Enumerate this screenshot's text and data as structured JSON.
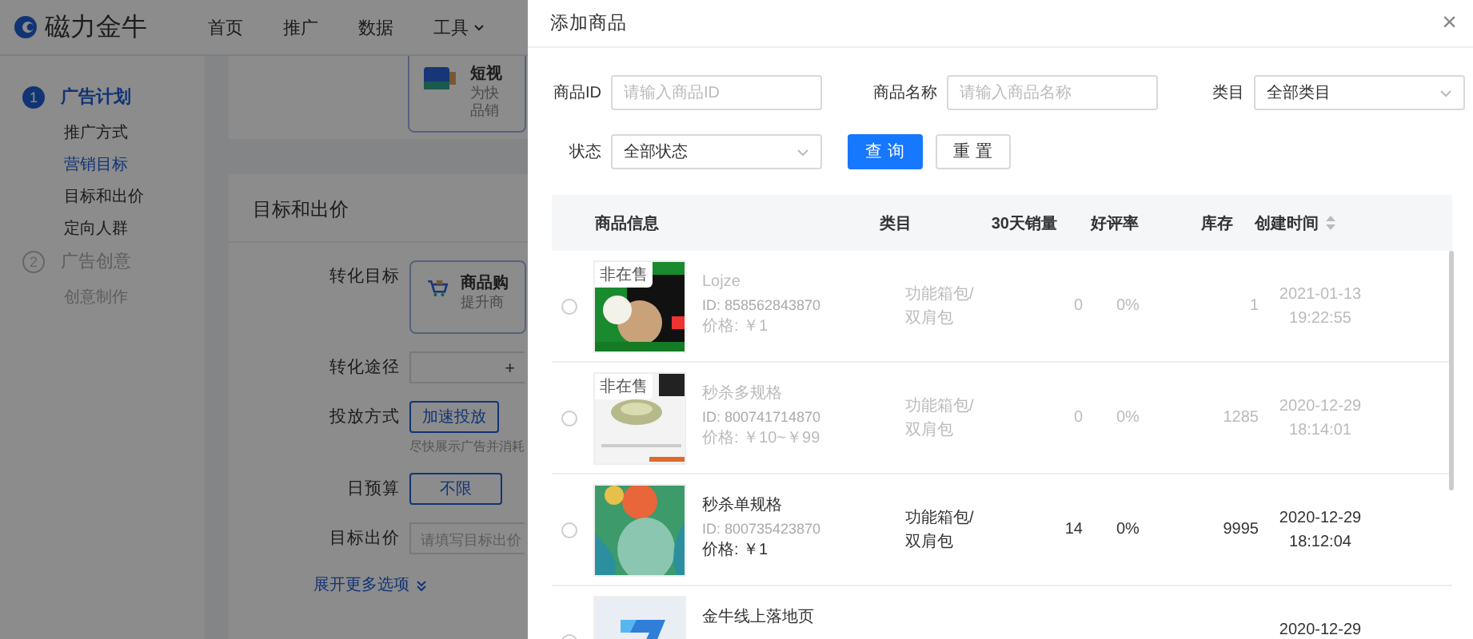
{
  "app": {
    "logo": "磁力金牛",
    "nav": [
      {
        "label": "首页",
        "kind": "link"
      },
      {
        "label": "推广",
        "kind": "link"
      },
      {
        "label": "数据",
        "kind": "link"
      },
      {
        "label": "工具",
        "kind": "menu"
      }
    ]
  },
  "sidebar": {
    "steps": [
      {
        "number": "1",
        "label": "广告计划",
        "active": true,
        "items": [
          {
            "label": "推广方式",
            "selected": false
          },
          {
            "label": "营销目标",
            "selected": true
          },
          {
            "label": "目标和出价",
            "selected": false
          },
          {
            "label": "定向人群",
            "selected": false
          }
        ]
      },
      {
        "number": "2",
        "label": "广告创意",
        "active": false,
        "items": [
          {
            "label": "创意制作",
            "selected": false
          }
        ]
      }
    ]
  },
  "top_card": {
    "title": "短视",
    "lines": [
      "为快",
      "品销"
    ]
  },
  "section": {
    "title": "目标和出价",
    "fields": [
      {
        "kind": "card",
        "label": "转化目标",
        "title": "商品购",
        "desc": "提升商"
      },
      {
        "kind": "add",
        "label": "转化途径",
        "value": "+"
      },
      {
        "kind": "option",
        "label": "投放方式",
        "option": "加速投放",
        "hint": "尽快展示广告并消耗"
      },
      {
        "kind": "segment",
        "label": "日预算",
        "option": "不限"
      },
      {
        "kind": "input",
        "label": "目标出价",
        "placeholder": "请填写目标出价"
      }
    ],
    "more_link": "展开更多选项"
  },
  "drawer": {
    "title": "添加商品",
    "close": "×",
    "filters": [
      {
        "kind": "input",
        "label": "商品ID",
        "placeholder": "请输入商品ID"
      },
      {
        "kind": "input",
        "label": "商品名称",
        "placeholder": "请输入商品名称"
      },
      {
        "kind": "select",
        "label": "类目",
        "value": "全部类目"
      },
      {
        "kind": "select",
        "label": "状态",
        "value": "全部状态"
      }
    ],
    "buttons": [
      {
        "label": "查 询",
        "kind": "primary"
      },
      {
        "label": "重 置",
        "kind": "default"
      }
    ],
    "columns": [
      {
        "label": "商品信息",
        "kind": "plain"
      },
      {
        "label": "类目",
        "kind": "plain"
      },
      {
        "label": "30天销量",
        "kind": "plain"
      },
      {
        "label": "好评率",
        "kind": "plain"
      },
      {
        "label": "库存",
        "kind": "plain"
      },
      {
        "label": "创建时间",
        "kind": "sortable"
      }
    ],
    "rows": [
      {
        "selected": false,
        "disabled": true,
        "badge": "非在售",
        "name": "Lojze",
        "id": "ID: 858562843870",
        "price": "价格: ￥1",
        "category": "功能箱包/\n双肩包",
        "sales": "0",
        "rating": "0%",
        "stock": "1",
        "created": "2021-01-13\n19:22:55"
      },
      {
        "selected": false,
        "disabled": true,
        "badge": "非在售",
        "name": "秒杀多规格",
        "id": "ID: 800741714870",
        "price": "价格: ￥10~￥99",
        "category": "功能箱包/\n双肩包",
        "sales": "0",
        "rating": "0%",
        "stock": "1285",
        "created": "2020-12-29\n18:14:01"
      },
      {
        "selected": false,
        "disabled": false,
        "name": "秒杀单规格",
        "id": "ID: 800735423870",
        "price": "价格: ￥1",
        "category": "功能箱包/\n双肩包",
        "sales": "14",
        "rating": "0%",
        "stock": "9995",
        "created": "2020-12-29\n18:12:04"
      },
      {
        "selected": false,
        "disabled": false,
        "name": "金牛线上落地页",
        "created": "2020-12-29"
      }
    ]
  }
}
